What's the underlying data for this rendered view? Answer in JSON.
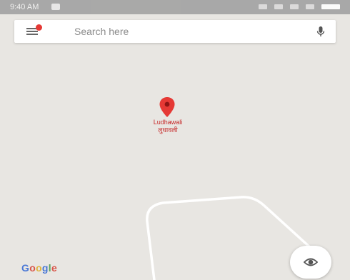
{
  "status_bar": {
    "time": "9:40 AM",
    "background": "#9e9e9e"
  },
  "search": {
    "placeholder": "Search here",
    "value": "",
    "menu_icon": "hamburger-menu-icon",
    "mic_icon": "microphone-icon"
  },
  "map": {
    "place_name_en": "Ludhawali",
    "place_name_hi": "लुधावली",
    "pin_color": "#e53935",
    "attribution": "Google",
    "locate_icon": "eye-location-icon"
  },
  "colors": {
    "map_background": "#e8e6e2",
    "road": "#ffffff",
    "accent_red": "#e53935"
  }
}
